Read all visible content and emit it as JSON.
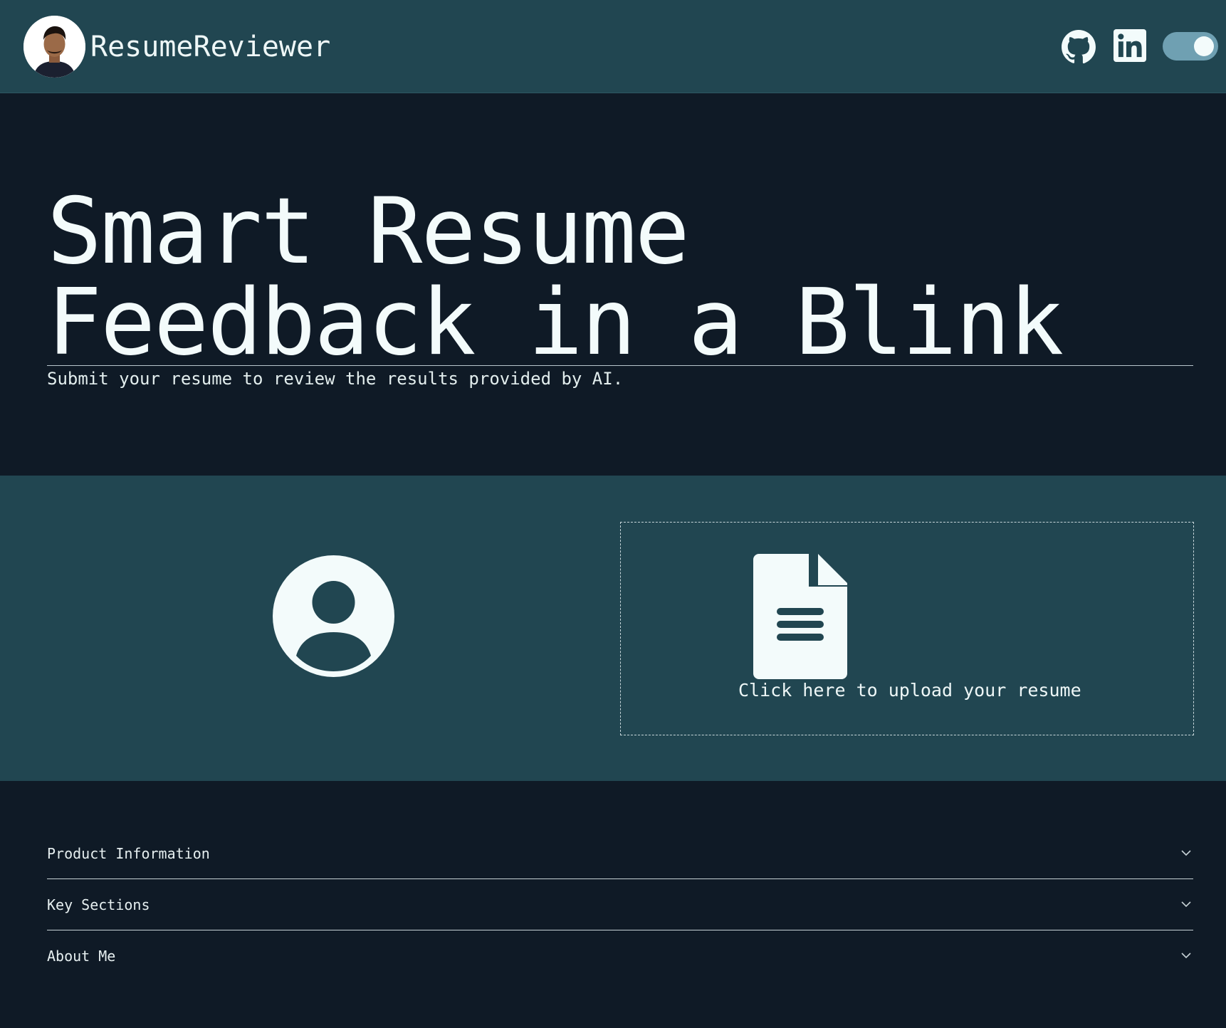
{
  "header": {
    "brand": "ResumeReviewer",
    "github_icon": "github-icon",
    "linkedin_icon": "linkedin-icon",
    "theme_toggle_on": true
  },
  "hero": {
    "title_line1": "Smart Resume",
    "title_line2": "Feedback in a Blink",
    "subtitle": "Submit your resume to review the results provided by AI."
  },
  "upload": {
    "user_icon": "user-circle-icon",
    "doc_icon": "document-icon",
    "label": "Click here to upload your resume"
  },
  "accordion": [
    {
      "label": "Product Information"
    },
    {
      "label": "Key Sections"
    },
    {
      "label": "About Me"
    }
  ],
  "colors": {
    "header_bg": "#214651",
    "page_bg": "#0f1a26",
    "band_bg": "#214651",
    "toggle": "#6fa0b2",
    "text": "#eef7f7"
  }
}
